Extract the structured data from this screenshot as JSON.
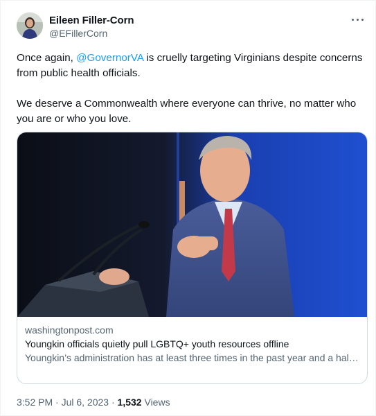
{
  "author": {
    "name": "Eileen Filler-Corn",
    "handle": "@EFillerCorn"
  },
  "tweet": {
    "text_1_before": "Once again, ",
    "mention": "@GovernorVA",
    "text_1_after": " is cruelly targeting Virginians despite concerns from public health officials.",
    "text_2": "We deserve a Commonwealth where everyone can thrive, no matter who you are or who you love."
  },
  "card": {
    "domain": "washingtonpost.com",
    "title": "Youngkin officials quietly pull LGBTQ+ youth resources offline",
    "description": "Youngkin’s administration has at least three times in the past year and a half removed information from the website without consulting its own subject ..."
  },
  "meta": {
    "time": "3:52 PM",
    "separator": " · ",
    "date": "Jul 6, 2023",
    "views_count": "1,532",
    "views_label": " Views"
  },
  "icons": {
    "more": "more-horizontal-icon"
  },
  "colors": {
    "link": "#1d9bf0",
    "secondary_text": "#536471",
    "border": "#cfd9de"
  }
}
